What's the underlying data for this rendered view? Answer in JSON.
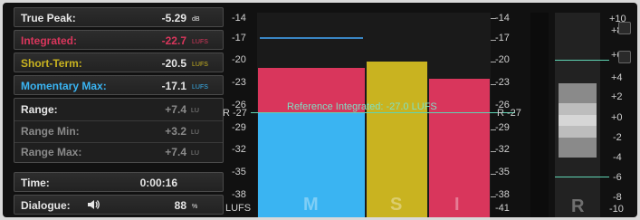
{
  "readouts": {
    "true_peak": {
      "label": "True Peak:",
      "value": "-5.29",
      "unit": "dB"
    },
    "integrated": {
      "label": "Integrated:",
      "value": "-22.7",
      "unit": "LUFS"
    },
    "short_term": {
      "label": "Short-Term:",
      "value": "-20.5",
      "unit": "LUFS"
    },
    "momentary_max": {
      "label": "Momentary Max:",
      "value": "-17.1",
      "unit": "LUFS"
    },
    "range": {
      "label": "Range:",
      "value": "+7.4",
      "unit": "LU"
    },
    "range_min": {
      "label": "Range Min:",
      "value": "+3.2",
      "unit": "LU"
    },
    "range_max": {
      "label": "Range Max:",
      "value": "+7.4",
      "unit": "LU"
    },
    "time": {
      "label": "Time:",
      "value": "0:00:16"
    },
    "dialogue": {
      "label": "Dialogue:",
      "value": "88",
      "unit": "%"
    }
  },
  "colors": {
    "integrated": "#d9365c",
    "short_term": "#c9b320",
    "momentary": "#3ab4f2",
    "reference": "#5fd4b3"
  },
  "meter": {
    "left_scale": [
      "-14",
      "-17",
      "-20",
      "-23",
      "-26",
      "R -27",
      "-29",
      "-32",
      "-35",
      "-38",
      "LUFS"
    ],
    "right_scale": [
      "-14",
      "-17",
      "-20",
      "-23",
      "-26",
      "R -27",
      "-29",
      "-32",
      "-35",
      "-38",
      "-41"
    ],
    "reference_label": "Reference Integrated: -27.0 LUFS",
    "bars": {
      "M": "M",
      "S": "S",
      "I": "I"
    },
    "range_meter_label": "R",
    "range_scale": [
      "+10",
      "+8",
      "+6",
      "+4",
      "+2",
      "+0",
      "-2",
      "-4",
      "-6",
      "-8",
      "-10"
    ]
  }
}
